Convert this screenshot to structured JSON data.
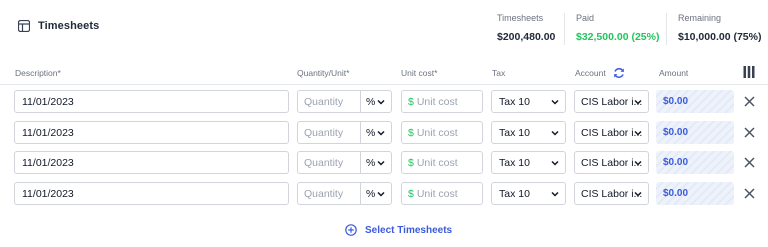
{
  "header": {
    "title": "Timesheets",
    "stats": [
      {
        "label": "Timesheets",
        "value": "$200,480.00"
      },
      {
        "label": "Paid",
        "value": "$32,500.00 (25%)"
      },
      {
        "label": "Remaining",
        "value": "$10,000.00 (75%)"
      }
    ]
  },
  "columns": {
    "description": "Description*",
    "quantity": "Quantity/Unit*",
    "unit_cost": "Unit cost*",
    "tax": "Tax",
    "account": "Account",
    "amount": "Amount"
  },
  "rows": [
    {
      "description": "11/01/2023",
      "quantity_placeholder": "Quantity",
      "unit": "%",
      "currency": "$",
      "cost_placeholder": "Unit cost",
      "tax": "Tax 10",
      "account": "CIS Labor i...",
      "amount": "$0.00"
    },
    {
      "description": "11/01/2023",
      "quantity_placeholder": "Quantity",
      "unit": "%",
      "currency": "$",
      "cost_placeholder": "Unit cost",
      "tax": "Tax 10",
      "account": "CIS Labor i...",
      "amount": "$0.00"
    },
    {
      "description": "11/01/2023",
      "quantity_placeholder": "Quantity",
      "unit": "%",
      "currency": "$",
      "cost_placeholder": "Unit cost",
      "tax": "Tax 10",
      "account": "CIS Labor i...",
      "amount": "$0.00"
    },
    {
      "description": "11/01/2023",
      "quantity_placeholder": "Quantity",
      "unit": "%",
      "currency": "$",
      "cost_placeholder": "Unit cost",
      "tax": "Tax 10",
      "account": "CIS Labor i...",
      "amount": "$0.00"
    }
  ],
  "footer": {
    "select_label": "Select Timesheets"
  },
  "colors": {
    "accent": "#3b5bdb",
    "paid": "#22c55e",
    "muted": "#6b7280"
  },
  "icons": {
    "title": "timesheet-icon",
    "refresh": "refresh-icon",
    "columns": "columns-icon",
    "remove": "close-icon",
    "add": "plus-circle-icon",
    "dropdown": "chevron-down-icon"
  }
}
